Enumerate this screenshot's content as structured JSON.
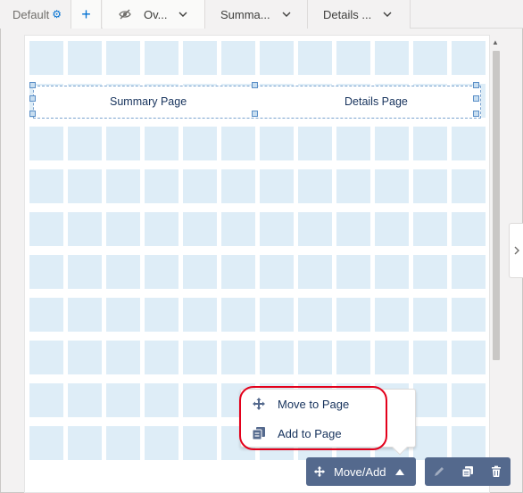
{
  "tabs": [
    {
      "label": "Default",
      "icon": "gear-icon"
    },
    {
      "label": "+",
      "icon": "plus-icon"
    },
    {
      "label": "Ov...",
      "icon": "hidden-eye-icon"
    },
    {
      "label": "Summa..."
    },
    {
      "label": "Details ..."
    }
  ],
  "tabset": {
    "tab1": "Summary Page",
    "tab2": "Details Page"
  },
  "menu": {
    "move": "Move to Page",
    "add": "Add to Page"
  },
  "actions": {
    "move_add": "Move/Add"
  },
  "colors": {
    "accent": "#0070d2",
    "grid_cell": "#deedf7",
    "action_bar": "#54698d",
    "highlight": "#e3001b"
  }
}
